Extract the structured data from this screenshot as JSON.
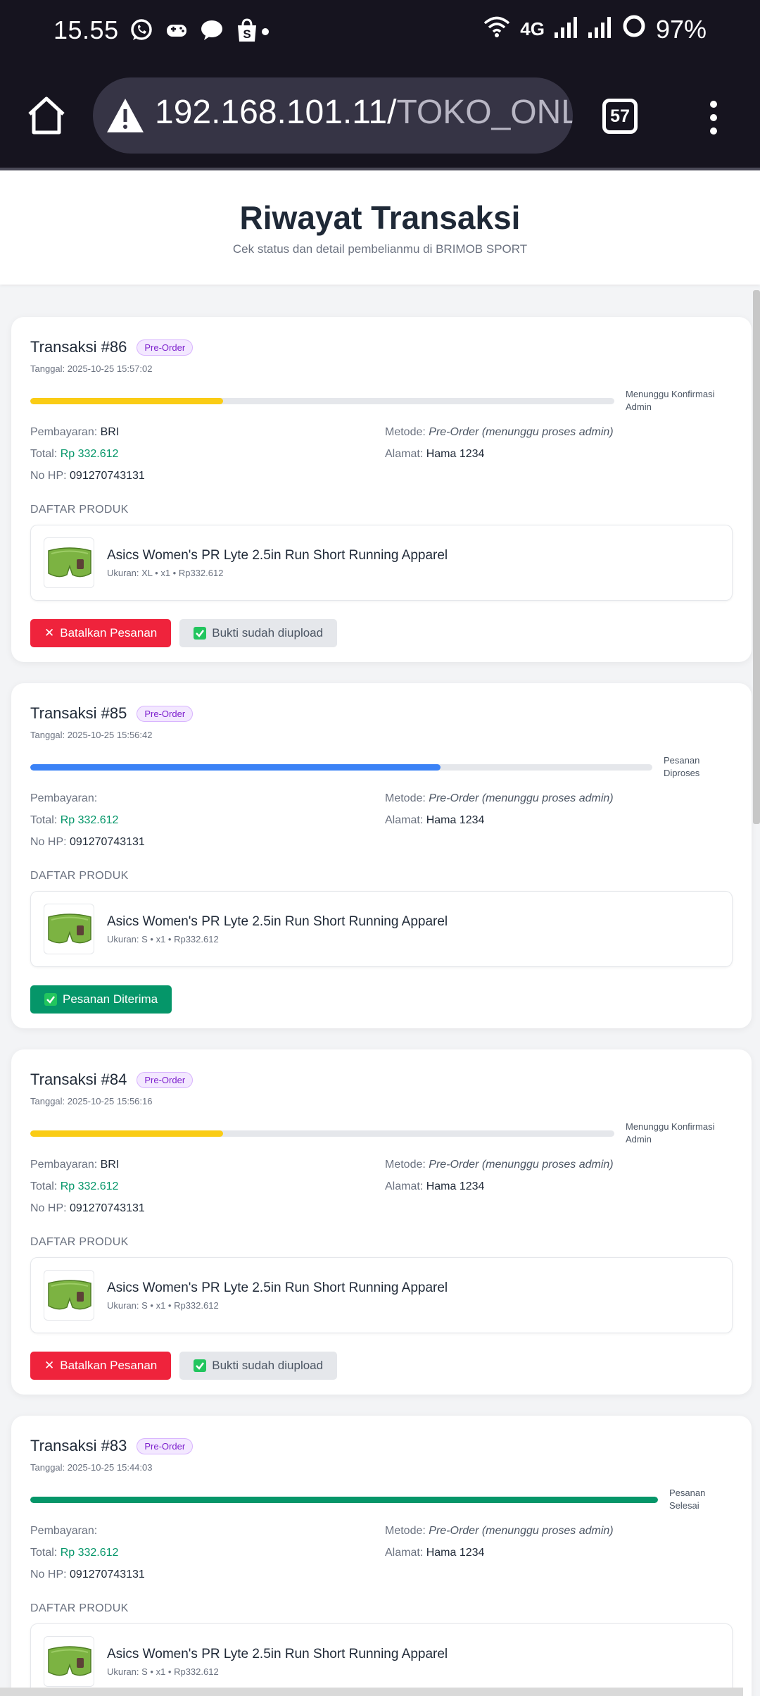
{
  "statusbar": {
    "time": "15.55",
    "network": "4G",
    "battery": "97%"
  },
  "browser": {
    "url_main": "192.168.101.11/",
    "url_path": "TOKO_ONLINE/u",
    "tab_count": "57"
  },
  "page": {
    "title": "Riwayat Transaksi",
    "subtitle": "Cek status dan detail pembelianmu di BRIMOB SPORT"
  },
  "labels": {
    "payment": "Pembayaran:",
    "total": "Total:",
    "phone": "No HP:",
    "method": "Metode:",
    "address": "Alamat:",
    "products": "DAFTAR PRODUK",
    "cancel": "Batalkan Pesanan",
    "proof": "Bukti sudah diupload",
    "received": "Pesanan Diterima"
  },
  "transactions": [
    {
      "title": "Transaksi #86",
      "badge": "Pre-Order",
      "date": "Tanggal: 2025-10-25 15:57:02",
      "status_line1": "Menunggu Konfirmasi",
      "status_line2": "Admin",
      "progress": 0.33,
      "progress_color": "#facc15",
      "payment": "BRI",
      "total": "Rp 332.612",
      "phone": "091270743131",
      "method": "Pre-Order (menunggu proses admin)",
      "address": "Hama 1234",
      "product_name": "Asics Women's PR Lyte 2.5in Run Short Running Apparel",
      "product_meta": "Ukuran: XL • x1 • Rp332.612"
    },
    {
      "title": "Transaksi #85",
      "badge": "Pre-Order",
      "date": "Tanggal: 2025-10-25 15:56:42",
      "status_line1": "Pesanan",
      "status_line2": "Diproses",
      "progress": 0.66,
      "progress_color": "#3b82f6",
      "payment": "",
      "total": "Rp 332.612",
      "phone": "091270743131",
      "method": "Pre-Order (menunggu proses admin)",
      "address": "Hama 1234",
      "product_name": "Asics Women's PR Lyte 2.5in Run Short Running Apparel",
      "product_meta": "Ukuran: S • x1 • Rp332.612"
    },
    {
      "title": "Transaksi #84",
      "badge": "Pre-Order",
      "date": "Tanggal: 2025-10-25 15:56:16",
      "status_line1": "Menunggu Konfirmasi",
      "status_line2": "Admin",
      "progress": 0.33,
      "progress_color": "#facc15",
      "payment": "BRI",
      "total": "Rp 332.612",
      "phone": "091270743131",
      "method": "Pre-Order (menunggu proses admin)",
      "address": "Hama 1234",
      "product_name": "Asics Women's PR Lyte 2.5in Run Short Running Apparel",
      "product_meta": "Ukuran: S • x1 • Rp332.612"
    },
    {
      "title": "Transaksi #83",
      "badge": "Pre-Order",
      "date": "Tanggal: 2025-10-25 15:44:03",
      "status_line1": "Pesanan",
      "status_line2": "Selesai",
      "progress": 1.0,
      "progress_color": "#059669",
      "payment": "",
      "total": "Rp 332.612",
      "phone": "091270743131",
      "method": "Pre-Order (menunggu proses admin)",
      "address": "Hama 1234",
      "product_name": "Asics Women's PR Lyte 2.5in Run Short Running Apparel",
      "product_meta": "Ukuran: S • x1 • Rp332.612"
    }
  ]
}
